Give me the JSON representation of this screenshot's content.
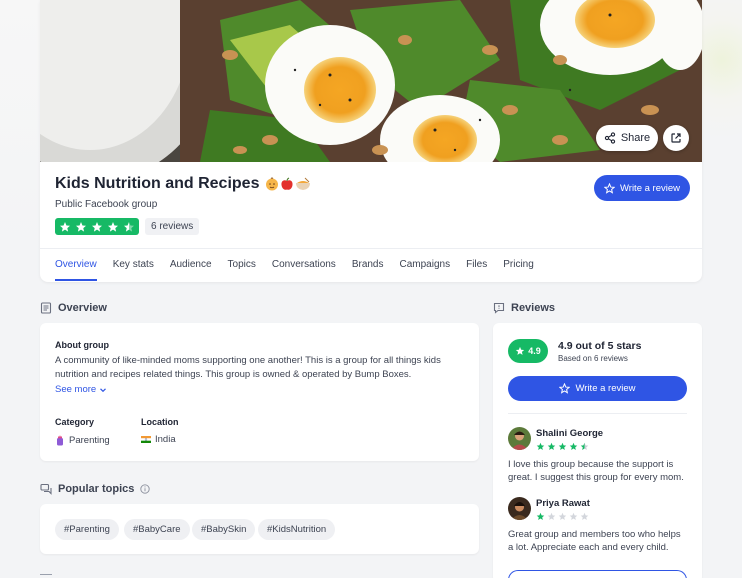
{
  "group": {
    "title": "Kids Nutrition and Recipes",
    "subtitle": "Public Facebook group",
    "rating_stars": 4.5,
    "reviews_count_label": "6 reviews"
  },
  "cover": {
    "share_label": "Share",
    "external_icon": "external-link-icon"
  },
  "header": {
    "write_review_label": "Write a review"
  },
  "tabs": [
    {
      "label": "Overview",
      "active": true
    },
    {
      "label": "Key stats"
    },
    {
      "label": "Audience"
    },
    {
      "label": "Topics"
    },
    {
      "label": "Conversations"
    },
    {
      "label": "Brands"
    },
    {
      "label": "Campaigns"
    },
    {
      "label": "Files"
    },
    {
      "label": "Pricing"
    }
  ],
  "overview": {
    "heading": "Overview",
    "about_label": "About group",
    "about_text": "A community of like-minded moms supporting one another! This is a group for all things kids nutrition and recipes related things. This group is owned & operated by Bump Boxes.",
    "see_more_label": "See more",
    "category_label": "Category",
    "category_value": "Parenting",
    "location_label": "Location",
    "location_value": "India"
  },
  "popular_topics": {
    "heading": "Popular topics",
    "chips": [
      "#Parenting",
      "#BabyCare",
      "#BabySkin",
      "#KidsNutrition"
    ]
  },
  "reviews": {
    "heading": "Reviews",
    "score": "4.9",
    "score_label": "4.9 out of 5 stars",
    "based_on": "Based on 6 reviews",
    "write_review_label": "Write a review",
    "items": [
      {
        "name": "Shalini George",
        "stars": 4.5,
        "text": "I love this group because the support is great. I suggest this group for every mom."
      },
      {
        "name": "Priya Rawat",
        "stars": 1,
        "text": "Great group and members too who helps a lot. Appreciate each and every child."
      }
    ]
  },
  "colors": {
    "accent": "#2f55e4",
    "star_green": "#16b965"
  }
}
